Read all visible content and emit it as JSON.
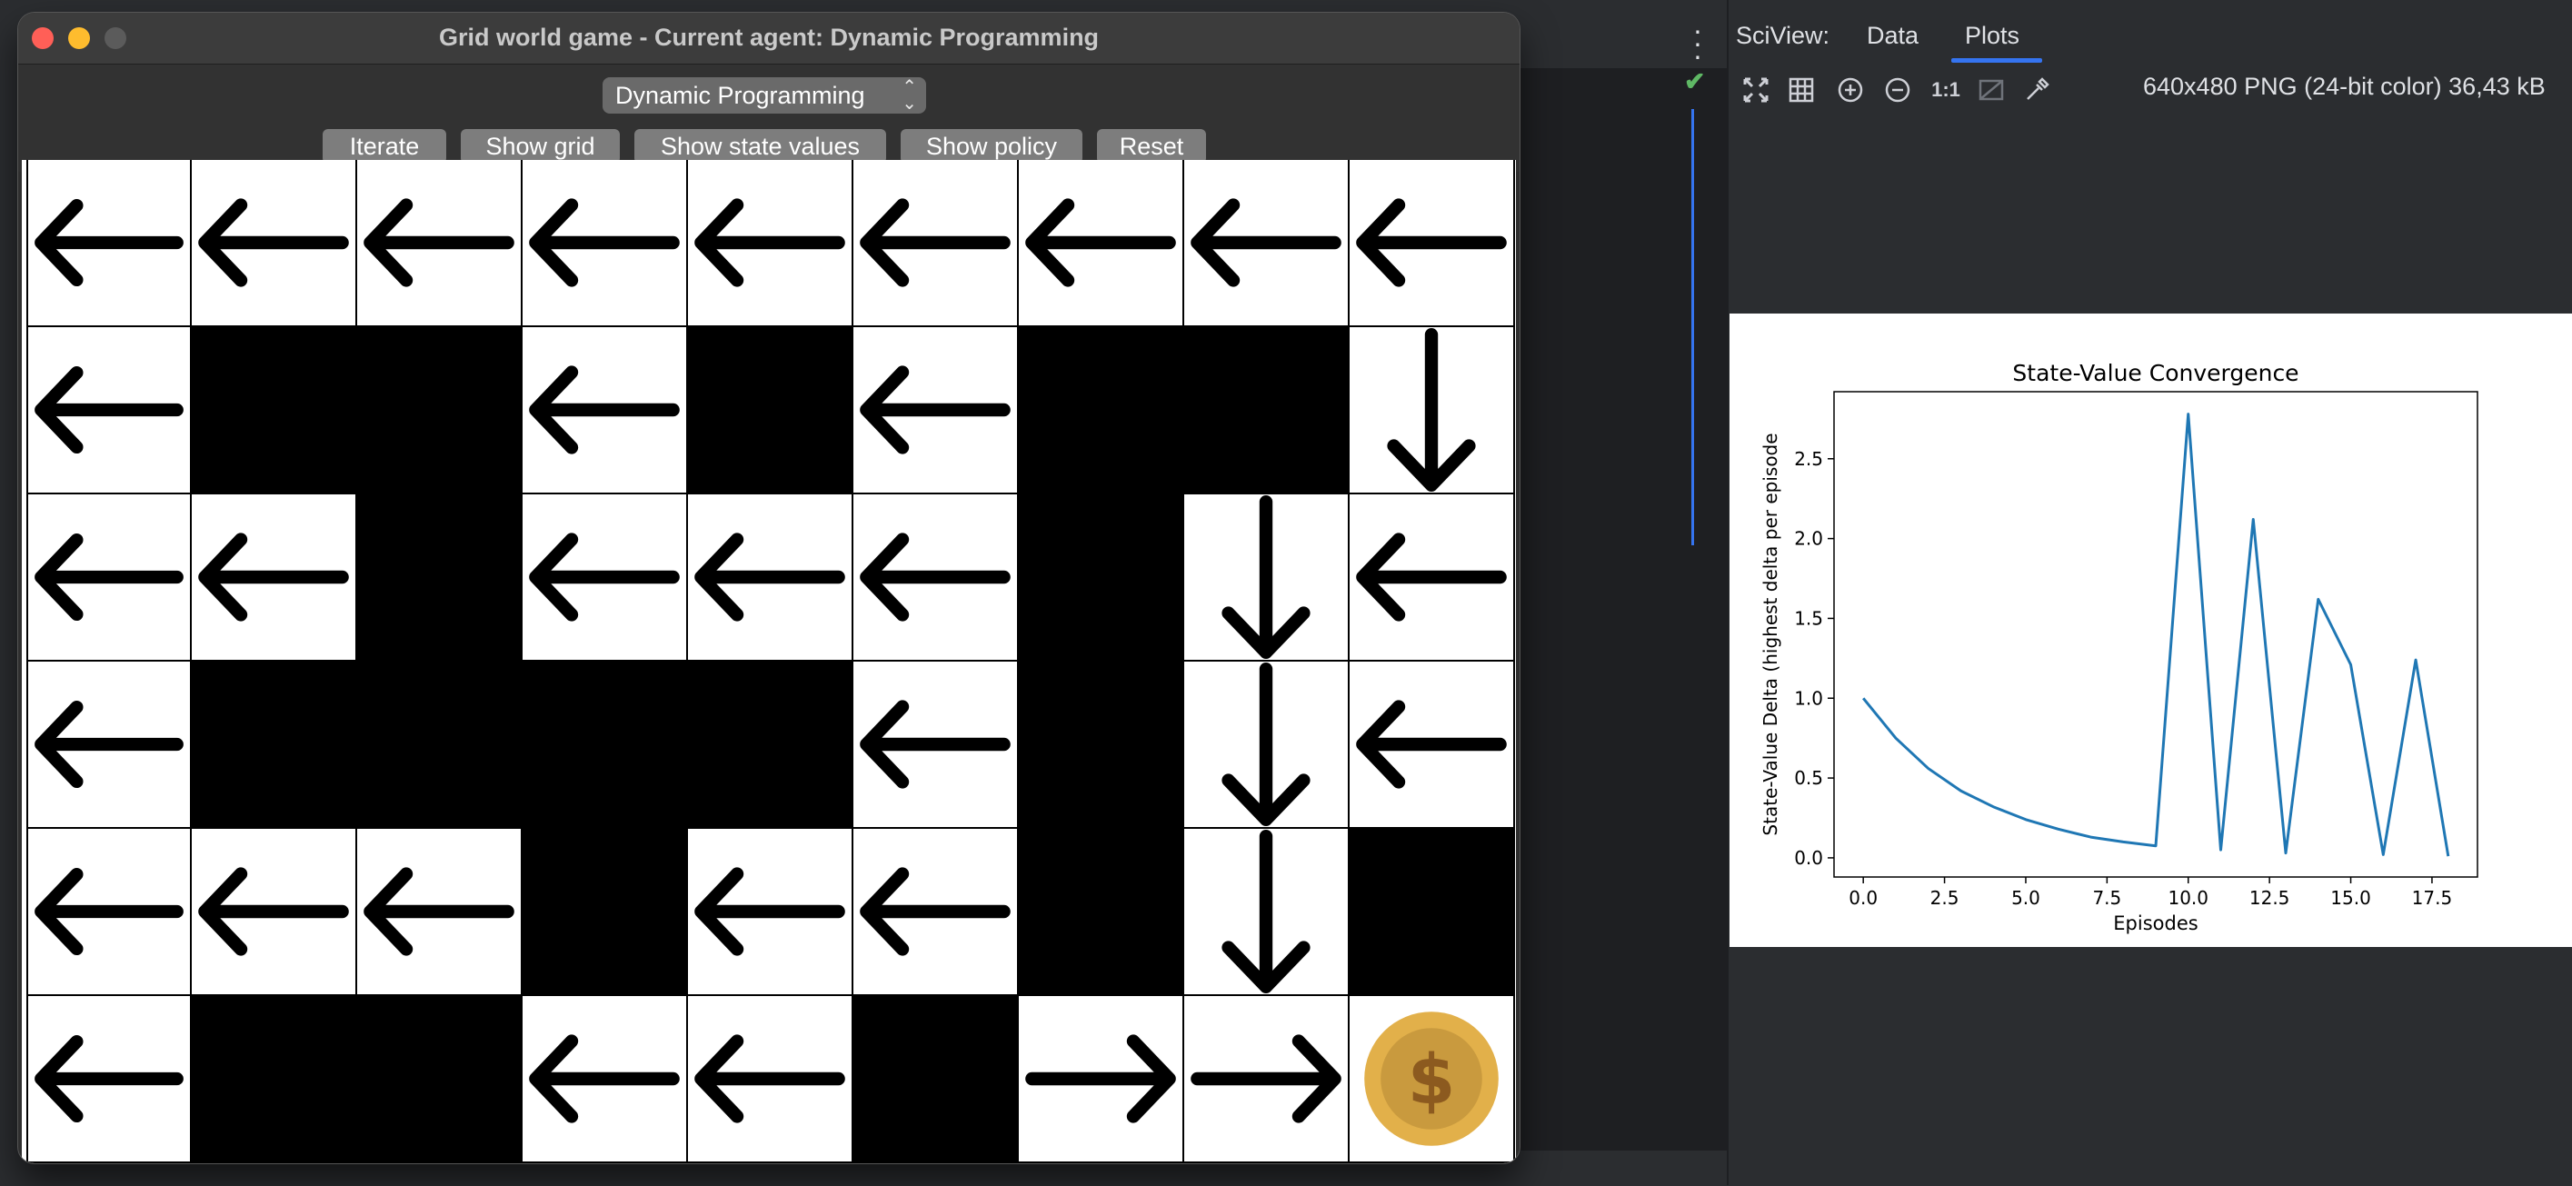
{
  "game_window": {
    "title": "Grid world game - Current agent: Dynamic Programming",
    "agent_select": {
      "selected": "Dynamic Programming"
    },
    "buttons": {
      "iterate": "Iterate",
      "show_grid": "Show grid",
      "show_state_values": "Show state values",
      "show_policy": "Show policy",
      "reset": "Reset"
    },
    "grid": {
      "rows": 6,
      "cols": 9,
      "cells": [
        [
          "left",
          "left",
          "left",
          "left",
          "left",
          "left",
          "left",
          "left",
          "left"
        ],
        [
          "left",
          "wall",
          "wall",
          "left",
          "wall",
          "left",
          "wall",
          "wall",
          "down"
        ],
        [
          "left",
          "left",
          "wall",
          "left",
          "left",
          "left",
          "wall",
          "down",
          "left"
        ],
        [
          "left",
          "wall",
          "wall",
          "wall",
          "wall",
          "left",
          "wall",
          "down",
          "left"
        ],
        [
          "left",
          "left",
          "left",
          "wall",
          "left",
          "left",
          "wall",
          "down",
          "wall"
        ],
        [
          "left",
          "wall",
          "wall",
          "left",
          "left",
          "wall",
          "right",
          "right",
          "goal"
        ]
      ],
      "goal_symbol": "$",
      "colors": {
        "wall": "#000000",
        "empty": "#ffffff",
        "arrow": "#000000",
        "coin_outer": "#e2b04a",
        "coin_inner": "#c99a3e",
        "coin_symbol": "#8c5a1f"
      }
    }
  },
  "sciview": {
    "title": "SciView:",
    "tabs": [
      {
        "label": "Data",
        "active": false
      },
      {
        "label": "Plots",
        "active": true
      }
    ],
    "toolbar_icons": [
      "fit-to-window-icon",
      "grid-icon",
      "zoom-in-icon",
      "zoom-out-icon",
      "actual-size-icon",
      "background-toggle-icon",
      "color-picker-icon"
    ],
    "actual_size_label": "1:1",
    "image_info": "640x480 PNG (24-bit color) 36,43 kB"
  },
  "chart_data": {
    "type": "line",
    "title": "State-Value Convergence",
    "xlabel": "Episodes",
    "ylabel": "State-Value Delta (highest delta per episode",
    "x": [
      0,
      1,
      2,
      3,
      4,
      5,
      6,
      7,
      8,
      9,
      10,
      11,
      12,
      13,
      14,
      15,
      16,
      17,
      18
    ],
    "series": [
      {
        "values": [
          1.0,
          0.75,
          0.56,
          0.42,
          0.32,
          0.24,
          0.18,
          0.13,
          0.1,
          0.075,
          2.78,
          0.05,
          2.12,
          0.03,
          1.62,
          1.21,
          0.02,
          1.24,
          0.01
        ],
        "color": "#1f77b4"
      }
    ],
    "xlim": [
      -0.9,
      18.9
    ],
    "ylim": [
      -0.12,
      2.92
    ],
    "xticks": [
      0.0,
      2.5,
      5.0,
      7.5,
      10.0,
      12.5,
      15.0,
      17.5
    ],
    "xtick_labels": [
      "0.0",
      "2.5",
      "5.0",
      "7.5",
      "10.0",
      "12.5",
      "15.0",
      "17.5"
    ],
    "yticks": [
      0.0,
      0.5,
      1.0,
      1.5,
      2.0,
      2.5
    ],
    "ytick_labels": [
      "0.0",
      "0.5",
      "1.0",
      "1.5",
      "2.0",
      "2.5"
    ],
    "grid": false
  }
}
